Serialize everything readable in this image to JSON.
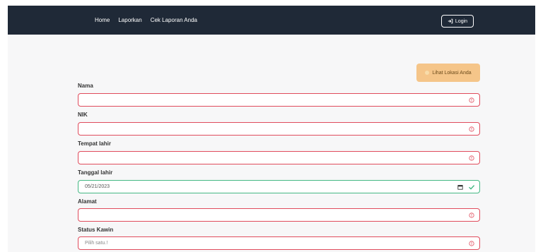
{
  "nav": {
    "links": [
      "Home",
      "Laporkan",
      "Cek Laporan Anda"
    ],
    "login_label": "Login"
  },
  "location_button": "Lihat Lokasi Anda",
  "form": {
    "nama": {
      "label": "Nama",
      "value": ""
    },
    "nik": {
      "label": "NIK",
      "value": ""
    },
    "tempat_lahir": {
      "label": "Tempat lahir",
      "value": ""
    },
    "tanggal_lahir": {
      "label": "Tanggal lahir",
      "value": "05/21/2023"
    },
    "alamat": {
      "label": "Alamat",
      "value": ""
    },
    "status_kawin": {
      "label": "Status Kawin",
      "placeholder": "Pilih satu.!"
    }
  },
  "colors": {
    "navbar": "#1f2937",
    "error": "#e04b5c",
    "valid": "#44b883",
    "location_button": "#f5c589"
  }
}
